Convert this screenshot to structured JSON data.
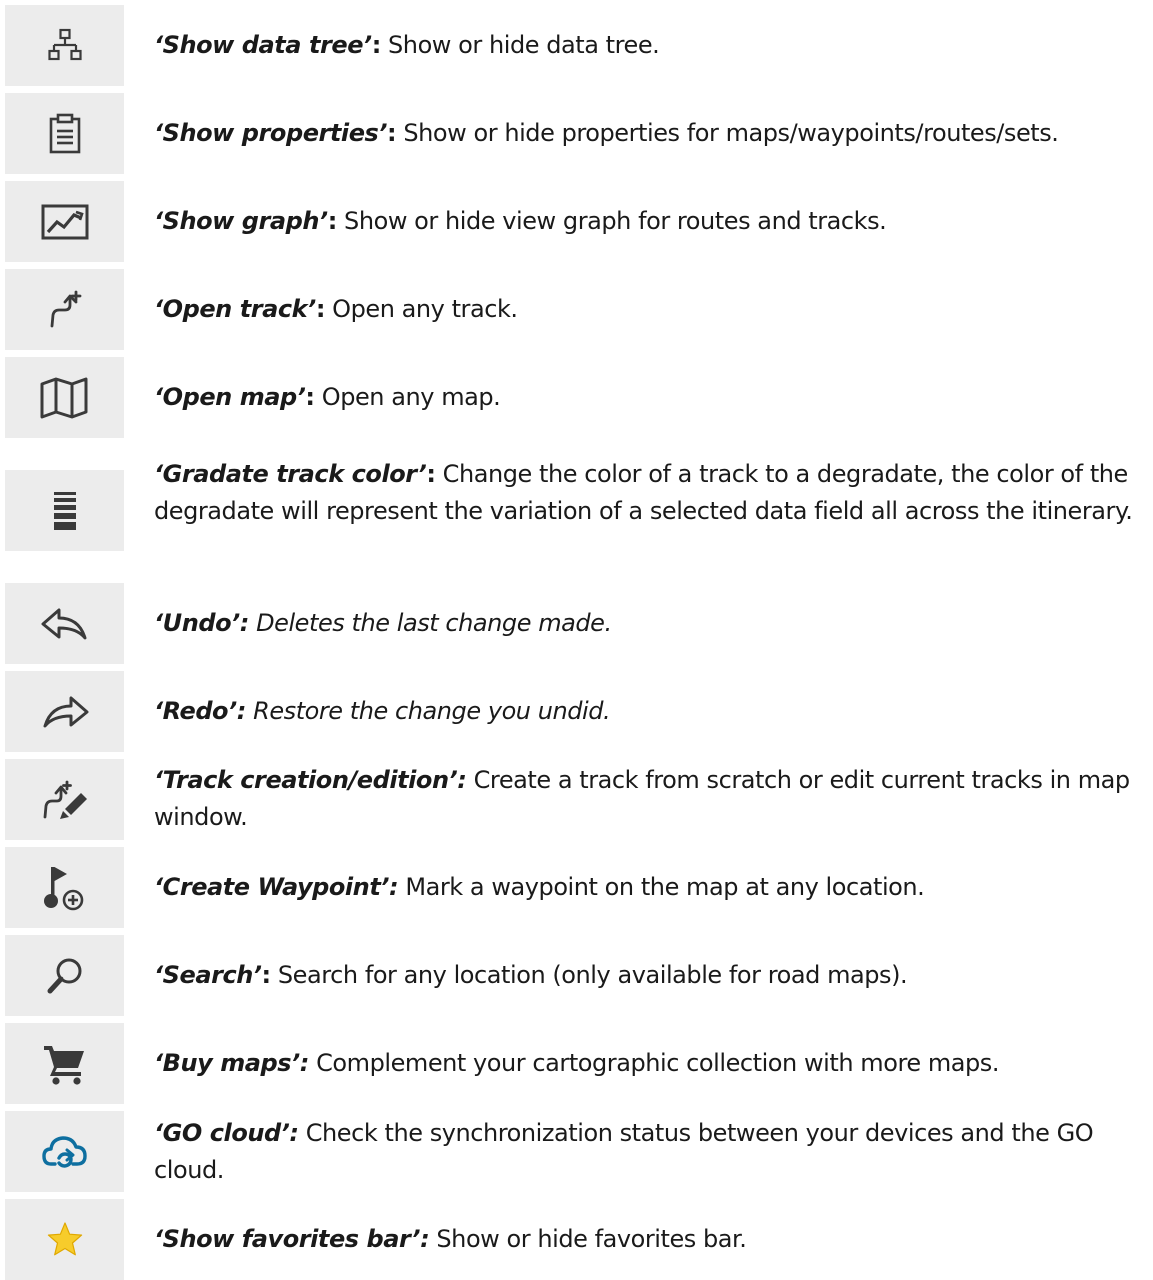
{
  "colors": {
    "icon_background": "#ececec",
    "icon_gray": "#3a3a3a",
    "cloud_blue": "#0e6fa0",
    "star_yellow": "#f7cc2b"
  },
  "items": [
    {
      "icon": "data-tree-icon",
      "name": "‘Show data tree’",
      "colon": ":",
      "text": " Show or hide data tree."
    },
    {
      "icon": "clipboard-icon",
      "name": "‘Show properties’",
      "colon": ":",
      "text": " Show or hide properties for maps/waypoints/routes/sets."
    },
    {
      "icon": "graph-icon",
      "name": "‘Show graph’",
      "colon": ":",
      "text": " Show or hide view graph for routes and tracks."
    },
    {
      "icon": "open-track-icon",
      "name": "‘Open track’",
      "colon": ":",
      "text": " Open any track."
    },
    {
      "icon": "map-icon",
      "name": "‘Open map’",
      "colon": ":",
      "text": " Open any map."
    },
    {
      "icon": "gradate-icon",
      "name": "‘Gradate track color’",
      "colon": ":",
      "text": " Change the color of a track to a degradate, the color of the degradate will represent the variation of a selected data field all across the itinerary."
    },
    {
      "icon": "undo-icon",
      "name": "‘Undo’:",
      "colon": "",
      "text": " Deletes the last change made."
    },
    {
      "icon": "redo-icon",
      "name": "‘Redo’:",
      "colon": "",
      "text": " Restore the change you undid."
    },
    {
      "icon": "track-edit-icon",
      "name": "‘Track creation/edition’:",
      "colon": "",
      "text": " Create a track from scratch or edit current tracks in map window."
    },
    {
      "icon": "create-waypoint-icon",
      "name": "‘Create Waypoint’:",
      "colon": "",
      "text": " Mark a waypoint on the map at any location."
    },
    {
      "icon": "search-icon",
      "name": "‘Search’",
      "colon": ":",
      "text": " Search for any location (only available for road maps)."
    },
    {
      "icon": "cart-icon",
      "name": "‘Buy maps’:",
      "colon": "",
      "text": " Complement your cartographic collection with more maps."
    },
    {
      "icon": "cloud-sync-icon",
      "name": "‘GO cloud’:",
      "colon": "",
      "text": " Check the synchronization status between your devices and the GO cloud."
    },
    {
      "icon": "star-icon",
      "name": "‘Show favorites bar’:",
      "colon": "",
      "text": " Show or hide favorites bar."
    }
  ]
}
